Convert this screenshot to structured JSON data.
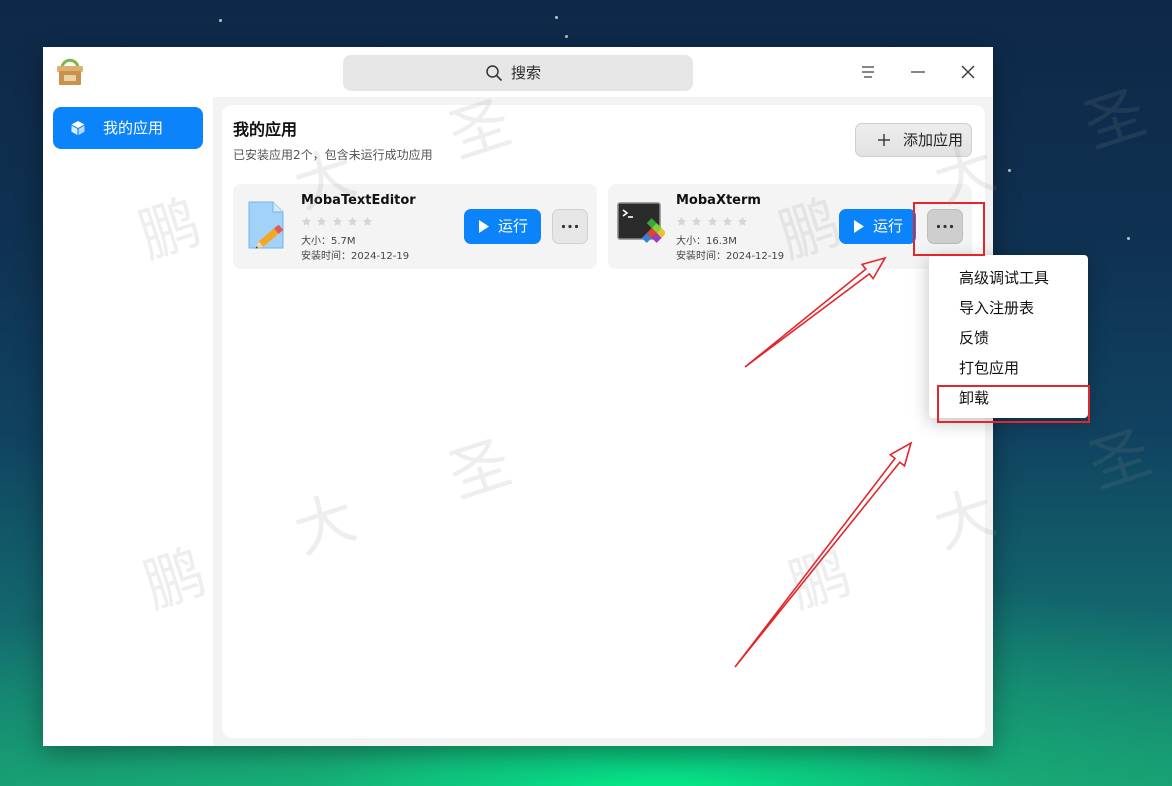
{
  "window": {
    "logo_icon": "package-box-icon",
    "search": {
      "placeholder": "搜索",
      "icon": "search-icon"
    },
    "controls": {
      "menu_icon": "menu-icon",
      "minimize_icon": "minimize-icon",
      "close_icon": "close-icon"
    }
  },
  "sidebar": {
    "items": [
      {
        "label": "我的应用",
        "icon": "cube-icon",
        "selected": true
      }
    ]
  },
  "main": {
    "title": "我的应用",
    "subtitle": "已安装应用2个，包含未运行成功应用",
    "add_button": {
      "label": "添加应用",
      "icon": "plus-icon"
    },
    "size_label": "大小：",
    "install_time_label": "安装时间：",
    "apps": [
      {
        "name": "MobaTextEditor",
        "icon": "text-editor-icon",
        "rating": 0,
        "rating_max": 5,
        "size": "5.7M",
        "install_time": "2024-12-19",
        "run_label": "运行",
        "run_icon": "play-icon",
        "more_icon": "more-icon",
        "menu_open": false
      },
      {
        "name": "MobaXterm",
        "icon": "terminal-icon",
        "rating": 0,
        "rating_max": 5,
        "size": "16.3M",
        "install_time": "2024-12-19",
        "run_label": "运行",
        "run_icon": "play-icon",
        "more_icon": "more-icon",
        "menu_open": true
      }
    ]
  },
  "context_menu": {
    "items": [
      "高级调试工具",
      "导入注册表",
      "反馈",
      "打包应用",
      "卸载"
    ]
  },
  "watermark": [
    "鹏",
    "大",
    "圣"
  ],
  "colors": {
    "accent": "#0a83fb",
    "star_empty": "#d6d6d6",
    "star_filled": "#f5a623",
    "annotation": "#e3262b"
  }
}
